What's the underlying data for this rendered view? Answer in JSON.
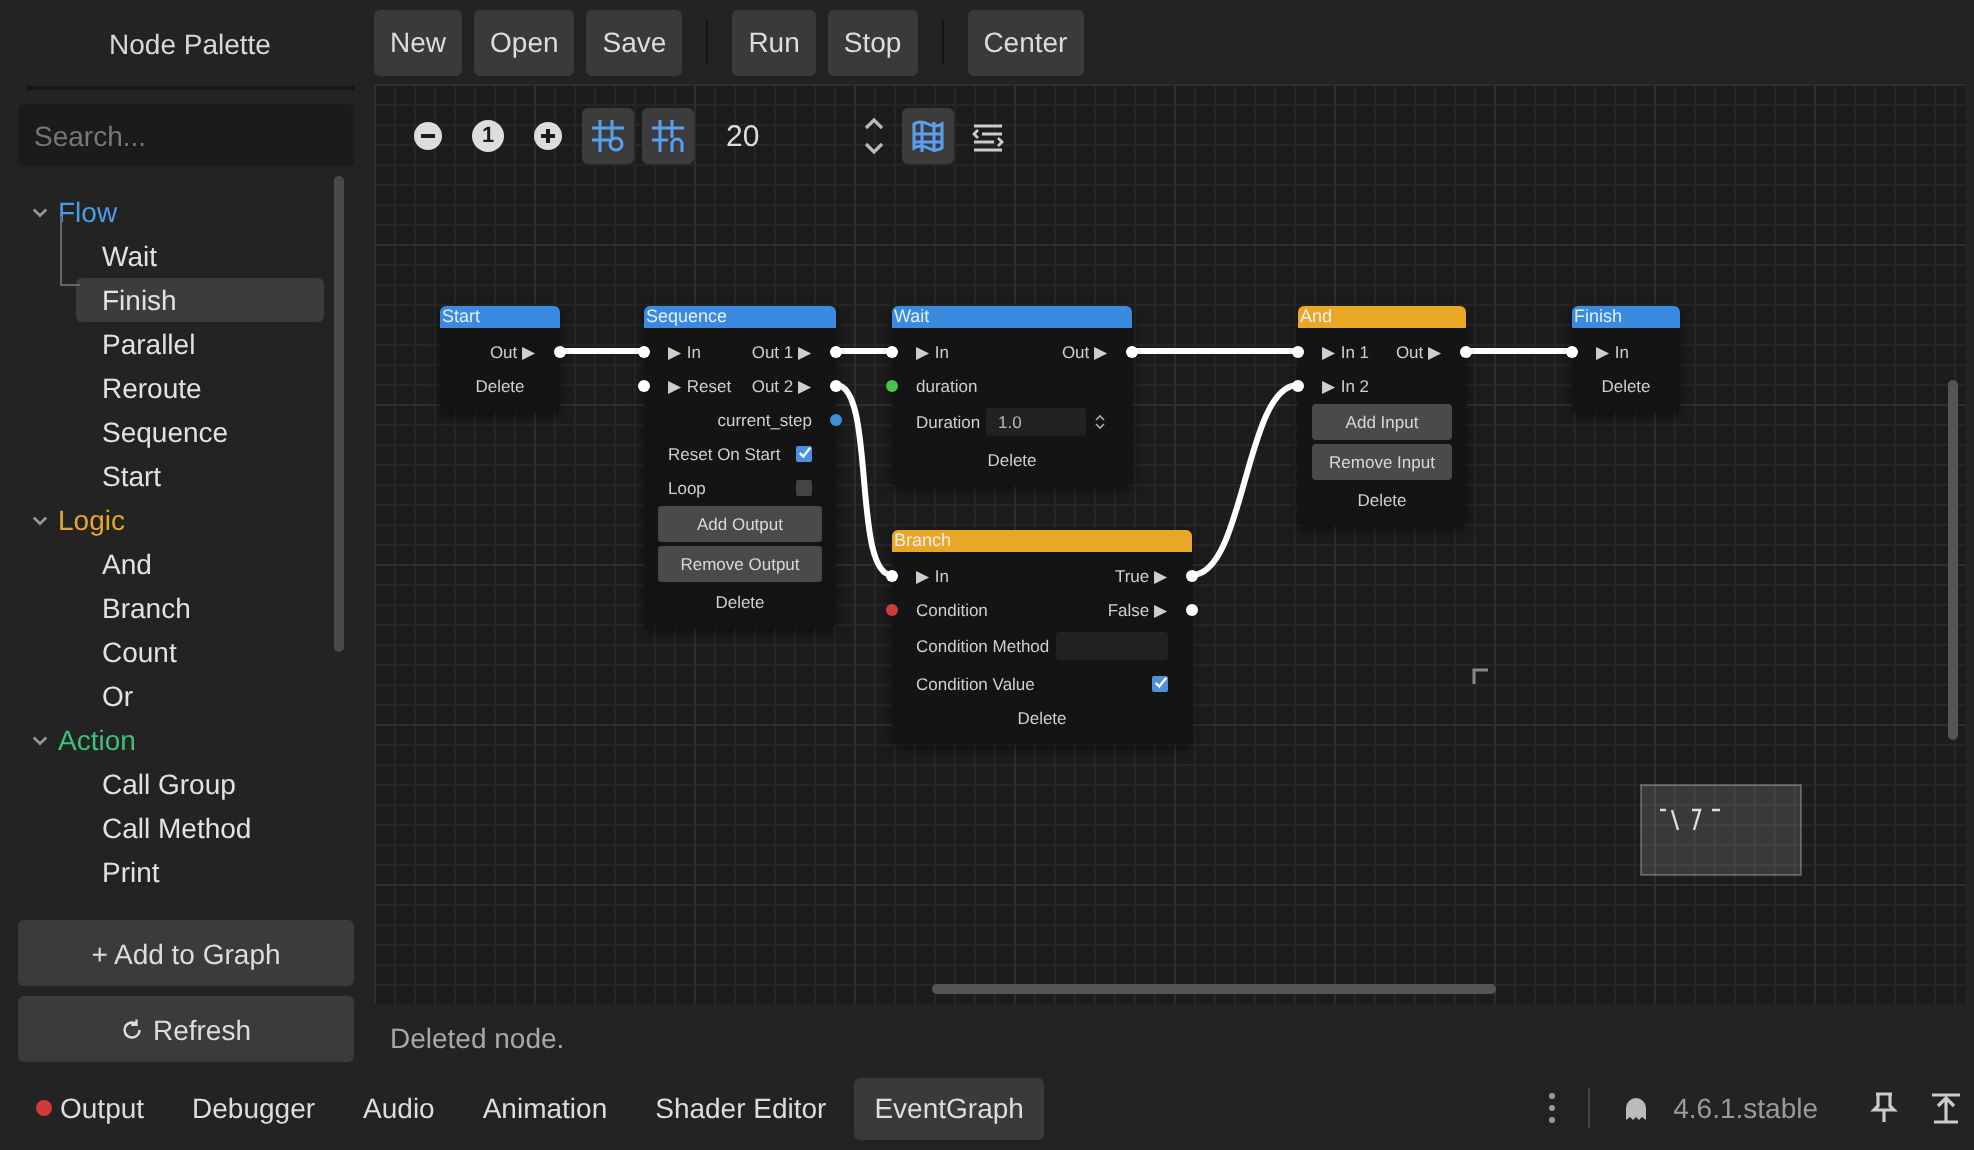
{
  "palette": {
    "title": "Node Palette",
    "search_placeholder": "Search...",
    "categories": [
      {
        "label": "Flow",
        "color": "#4a9de8",
        "expanded": true,
        "children": [
          {
            "label": "Wait",
            "selected": false
          },
          {
            "label": "Finish",
            "selected": true
          },
          {
            "label": "Parallel",
            "selected": false
          },
          {
            "label": "Reroute",
            "selected": false
          },
          {
            "label": "Sequence",
            "selected": false
          },
          {
            "label": "Start",
            "selected": false
          }
        ]
      },
      {
        "label": "Logic",
        "color": "#e8a825",
        "expanded": true,
        "children": [
          {
            "label": "And",
            "selected": false
          },
          {
            "label": "Branch",
            "selected": false
          },
          {
            "label": "Count",
            "selected": false
          },
          {
            "label": "Or",
            "selected": false
          }
        ]
      },
      {
        "label": "Action",
        "color": "#3cc07a",
        "expanded": true,
        "children": [
          {
            "label": "Call Group",
            "selected": false
          },
          {
            "label": "Call Method",
            "selected": false
          },
          {
            "label": "Print",
            "selected": false
          }
        ]
      }
    ],
    "buttons": [
      "+ Add to Graph",
      "Refresh"
    ]
  },
  "toolbar": {
    "groups": [
      [
        "New",
        "Open",
        "Save"
      ],
      [
        "Run",
        "Stop"
      ],
      [
        "Center"
      ]
    ]
  },
  "canvas_toolbar": {
    "reset_zoom": "1",
    "snap_on": true,
    "grid_on": true,
    "snap_distance": "20",
    "minimap_on": true
  },
  "nodes": [
    {
      "title": "Start",
      "color": "#3a8be0",
      "rows": [
        {
          "kind": "port",
          "right": "Out ▶",
          "out": {
            "color": "#ffffff"
          }
        },
        {
          "kind": "delete",
          "label": "Delete"
        }
      ]
    },
    {
      "title": "Sequence",
      "color": "#3a8be0",
      "rows": [
        {
          "kind": "port",
          "left": "▶ In",
          "right": "Out 1 ▶",
          "in": {
            "color": "#ffffff"
          },
          "out": {
            "color": "#ffffff"
          }
        },
        {
          "kind": "port",
          "left": "▶ Reset",
          "right": "Out 2 ▶",
          "in": {
            "color": "#ffffff"
          },
          "out": {
            "color": "#ffffff"
          }
        },
        {
          "kind": "port",
          "right": "current_step",
          "out": {
            "color": "#3d8fd6"
          }
        },
        {
          "kind": "check",
          "label": "Reset On Start",
          "checked": true
        },
        {
          "kind": "check",
          "label": "Loop",
          "checked": false
        },
        {
          "kind": "button",
          "label": "Add Output"
        },
        {
          "kind": "button",
          "label": "Remove Output"
        },
        {
          "kind": "delete",
          "label": "Delete"
        }
      ]
    },
    {
      "title": "Wait",
      "color": "#3a8be0",
      "rows": [
        {
          "kind": "port",
          "left": "▶ In",
          "right": "Out ▶",
          "in": {
            "color": "#ffffff"
          },
          "out": {
            "color": "#ffffff"
          }
        },
        {
          "kind": "port",
          "left": "duration",
          "in": {
            "color": "#4cc04c"
          }
        },
        {
          "kind": "number",
          "label": "Duration",
          "value": "1.0"
        },
        {
          "kind": "delete",
          "label": "Delete"
        }
      ]
    },
    {
      "title": "Branch",
      "color": "#e8a825",
      "rows": [
        {
          "kind": "port",
          "left": "▶ In",
          "right": "True ▶",
          "in": {
            "color": "#ffffff"
          },
          "out": {
            "color": "#ffffff"
          }
        },
        {
          "kind": "port",
          "left": "Condition",
          "right": "False ▶",
          "in": {
            "color": "#d03a3a"
          },
          "out": {
            "color": "#ffffff"
          }
        },
        {
          "kind": "text",
          "label": "Condition Method"
        },
        {
          "kind": "check",
          "label": "Condition Value",
          "checked": true
        },
        {
          "kind": "delete",
          "label": "Delete"
        }
      ]
    },
    {
      "title": "And",
      "color": "#e8a825",
      "rows": [
        {
          "kind": "port",
          "left": "▶ In 1",
          "right": "Out ▶",
          "in": {
            "color": "#ffffff"
          },
          "out": {
            "color": "#ffffff"
          }
        },
        {
          "kind": "port",
          "left": "▶ In 2",
          "in": {
            "color": "#ffffff"
          }
        },
        {
          "kind": "button",
          "label": "Add Input"
        },
        {
          "kind": "button",
          "label": "Remove Input"
        },
        {
          "kind": "delete",
          "label": "Delete"
        }
      ]
    },
    {
      "title": "Finish",
      "color": "#3a8be0",
      "rows": [
        {
          "kind": "port",
          "left": "▶ In",
          "in": {
            "color": "#ffffff"
          }
        },
        {
          "kind": "delete",
          "label": "Delete"
        }
      ]
    }
  ],
  "status": "Deleted node.",
  "bottom_tabs": [
    {
      "label": "Output",
      "selected": false,
      "color": "#d03a3a"
    },
    {
      "label": "Debugger",
      "selected": false
    },
    {
      "label": "Audio",
      "selected": false
    },
    {
      "label": "Animation",
      "selected": false
    },
    {
      "label": "Shader Editor",
      "selected": false
    },
    {
      "label": "EventGraph",
      "selected": true
    }
  ],
  "version": "4.6.1.stable"
}
